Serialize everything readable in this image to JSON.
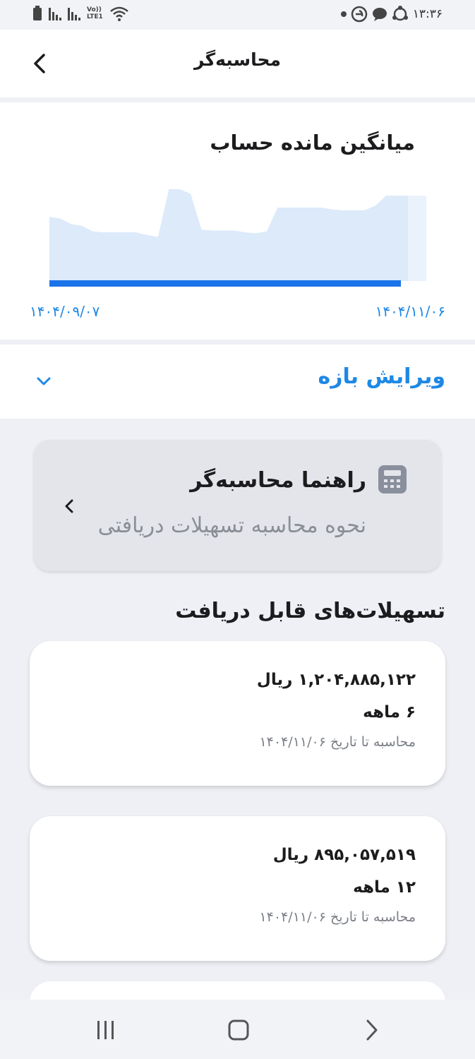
{
  "status_bar": {
    "time": "۱۳:۳۶",
    "icons": [
      "battery-icon",
      "signal-icon",
      "signal-icon",
      "volte-icon",
      "wifi-icon",
      "notification-dot-icon",
      "app-icon",
      "chat-icon",
      "sync-icon"
    ],
    "volte_text": "Vo))",
    "lte_text": "LTE1"
  },
  "header": {
    "title": "محاسبه‌گر",
    "back_icon": "chevron-left-icon"
  },
  "chart": {
    "title": "میانگین مانده حساب",
    "start_date": "۱۴۰۴/۰۹/۰۷",
    "end_date": "۱۴۰۴/۱۱/۰۶",
    "colors": {
      "area": "#dceafa",
      "area_dim": "#eaf2fc",
      "track": "#1a73e8"
    }
  },
  "chart_data": {
    "type": "area",
    "x_start": "۱۴۰۴/۰۹/۰۷",
    "x_end": "۱۴۰۴/۱۱/۰۶",
    "values": [
      0.7,
      0.68,
      0.62,
      0.6,
      0.54,
      0.53,
      0.53,
      0.53,
      0.53,
      0.5,
      0.48,
      1.0,
      1.0,
      0.95,
      0.56,
      0.55,
      0.55,
      0.55,
      0.53,
      0.52,
      0.54,
      0.8,
      0.8,
      0.8,
      0.8,
      0.8,
      0.78,
      0.77,
      0.77,
      0.77,
      0.82,
      0.93,
      0.93,
      0.93
    ],
    "ylim": [
      0,
      1
    ]
  },
  "range": {
    "label": "ویرایش بازه",
    "chevron_icon": "chevron-down-icon"
  },
  "guide": {
    "title": "راهنما محاسبه‌گر",
    "subtitle": "نحوه محاسبه تسهیلات دریافتی",
    "icon": "calculator-icon",
    "chevron_icon": "chevron-left-icon"
  },
  "loans_section": {
    "title": "تسهیلات‌های قابل دریافت",
    "items": [
      {
        "amount": "۱,۲۰۴,۸۸۵,۱۲۲ ریال",
        "term": "۶ ماهه",
        "date_note": "محاسبه تا تاریخ ۱۴۰۴/۱۱/۰۶"
      },
      {
        "amount": "۸۹۵,۰۵۷,۵۱۹ ریال",
        "term": "۱۲ ماهه",
        "date_note": "محاسبه تا تاریخ ۱۴۰۴/۱۱/۰۶"
      }
    ]
  },
  "nav_bar": {
    "recents_icon": "recents-icon",
    "home_icon": "home-icon",
    "back_icon": "back-icon"
  }
}
